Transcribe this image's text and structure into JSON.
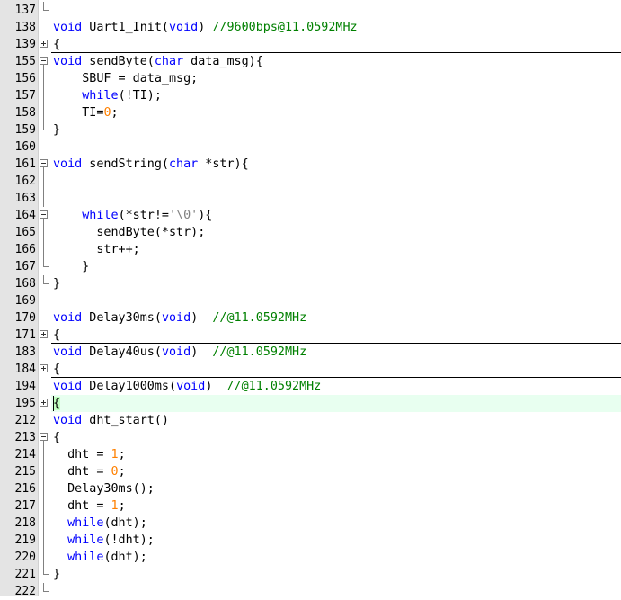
{
  "editor": {
    "lines": [
      {
        "num": "137",
        "fold": "end",
        "tokens": []
      },
      {
        "num": "138",
        "fold": "",
        "tokens": [
          {
            "t": "void",
            "c": "kw"
          },
          {
            "t": " Uart1_Init("
          },
          {
            "t": "void",
            "c": "kw"
          },
          {
            "t": ") "
          },
          {
            "t": "//9600bps@11.0592MHz",
            "c": "cmt"
          }
        ]
      },
      {
        "num": "139",
        "fold": "plus",
        "sep": true,
        "tokens": [
          {
            "t": "{"
          }
        ]
      },
      {
        "num": "155",
        "fold": "minus",
        "tokens": [
          {
            "t": "void",
            "c": "kw"
          },
          {
            "t": " sendByte("
          },
          {
            "t": "char",
            "c": "kw"
          },
          {
            "t": " data_msg){"
          }
        ]
      },
      {
        "num": "156",
        "fold": "line",
        "tokens": [
          {
            "t": "    SBUF = data_msg;"
          }
        ]
      },
      {
        "num": "157",
        "fold": "line",
        "tokens": [
          {
            "t": "    "
          },
          {
            "t": "while",
            "c": "kw"
          },
          {
            "t": "(!TI);"
          }
        ]
      },
      {
        "num": "158",
        "fold": "line",
        "tokens": [
          {
            "t": "    TI="
          },
          {
            "t": "0",
            "c": "num"
          },
          {
            "t": ";"
          }
        ]
      },
      {
        "num": "159",
        "fold": "end",
        "tokens": [
          {
            "t": "}"
          }
        ]
      },
      {
        "num": "160",
        "fold": "",
        "tokens": []
      },
      {
        "num": "161",
        "fold": "minus",
        "tokens": [
          {
            "t": "void",
            "c": "kw"
          },
          {
            "t": " sendString("
          },
          {
            "t": "char",
            "c": "kw"
          },
          {
            "t": " *str){"
          }
        ]
      },
      {
        "num": "162",
        "fold": "line",
        "tokens": []
      },
      {
        "num": "163",
        "fold": "line",
        "tokens": []
      },
      {
        "num": "164",
        "fold": "minus",
        "tokens": [
          {
            "t": "    "
          },
          {
            "t": "while",
            "c": "kw"
          },
          {
            "t": "(*str!="
          },
          {
            "t": "'\\0'",
            "c": "str"
          },
          {
            "t": "){"
          }
        ]
      },
      {
        "num": "165",
        "fold": "line",
        "tokens": [
          {
            "t": "      sendByte(*str);"
          }
        ]
      },
      {
        "num": "166",
        "fold": "line",
        "tokens": [
          {
            "t": "      str++;"
          }
        ]
      },
      {
        "num": "167",
        "fold": "end",
        "tokens": [
          {
            "t": "    }"
          }
        ]
      },
      {
        "num": "168",
        "fold": "end",
        "tokens": [
          {
            "t": "}"
          }
        ]
      },
      {
        "num": "169",
        "fold": "",
        "tokens": []
      },
      {
        "num": "170",
        "fold": "",
        "tokens": [
          {
            "t": "void",
            "c": "kw"
          },
          {
            "t": " Delay30ms("
          },
          {
            "t": "void",
            "c": "kw"
          },
          {
            "t": ")  "
          },
          {
            "t": "//@11.0592MHz",
            "c": "cmt"
          }
        ]
      },
      {
        "num": "171",
        "fold": "plus",
        "sep": true,
        "tokens": [
          {
            "t": "{"
          }
        ]
      },
      {
        "num": "183",
        "fold": "",
        "tokens": [
          {
            "t": "void",
            "c": "kw"
          },
          {
            "t": " Delay40us("
          },
          {
            "t": "void",
            "c": "kw"
          },
          {
            "t": ")  "
          },
          {
            "t": "//@11.0592MHz",
            "c": "cmt"
          }
        ]
      },
      {
        "num": "184",
        "fold": "plus",
        "sep": true,
        "tokens": [
          {
            "t": "{"
          }
        ]
      },
      {
        "num": "194",
        "fold": "",
        "tokens": [
          {
            "t": "void",
            "c": "kw"
          },
          {
            "t": " Delay1000ms("
          },
          {
            "t": "void",
            "c": "kw"
          },
          {
            "t": ")  "
          },
          {
            "t": "//@11.0592MHz",
            "c": "cmt"
          }
        ]
      },
      {
        "num": "195",
        "fold": "plus",
        "hl": true,
        "tokens": [
          {
            "t": "{",
            "c": "brace-hl"
          }
        ]
      },
      {
        "num": "212",
        "fold": "",
        "tokens": [
          {
            "t": "void",
            "c": "kw"
          },
          {
            "t": " dht_start()"
          }
        ]
      },
      {
        "num": "213",
        "fold": "minus",
        "tokens": [
          {
            "t": "{"
          }
        ]
      },
      {
        "num": "214",
        "fold": "line",
        "tokens": [
          {
            "t": "  dht = "
          },
          {
            "t": "1",
            "c": "num"
          },
          {
            "t": ";"
          }
        ]
      },
      {
        "num": "215",
        "fold": "line",
        "tokens": [
          {
            "t": "  dht = "
          },
          {
            "t": "0",
            "c": "num"
          },
          {
            "t": ";"
          }
        ]
      },
      {
        "num": "216",
        "fold": "line",
        "tokens": [
          {
            "t": "  Delay30ms();"
          }
        ]
      },
      {
        "num": "217",
        "fold": "line",
        "tokens": [
          {
            "t": "  dht = "
          },
          {
            "t": "1",
            "c": "num"
          },
          {
            "t": ";"
          }
        ]
      },
      {
        "num": "218",
        "fold": "line",
        "tokens": [
          {
            "t": "  "
          },
          {
            "t": "while",
            "c": "kw"
          },
          {
            "t": "(dht);"
          }
        ]
      },
      {
        "num": "219",
        "fold": "line",
        "tokens": [
          {
            "t": "  "
          },
          {
            "t": "while",
            "c": "kw"
          },
          {
            "t": "(!dht);"
          }
        ]
      },
      {
        "num": "220",
        "fold": "line",
        "tokens": [
          {
            "t": "  "
          },
          {
            "t": "while",
            "c": "kw"
          },
          {
            "t": "(dht);"
          }
        ]
      },
      {
        "num": "221",
        "fold": "end",
        "tokens": [
          {
            "t": "}"
          }
        ]
      },
      {
        "num": "222",
        "fold": "end",
        "tokens": []
      }
    ]
  }
}
